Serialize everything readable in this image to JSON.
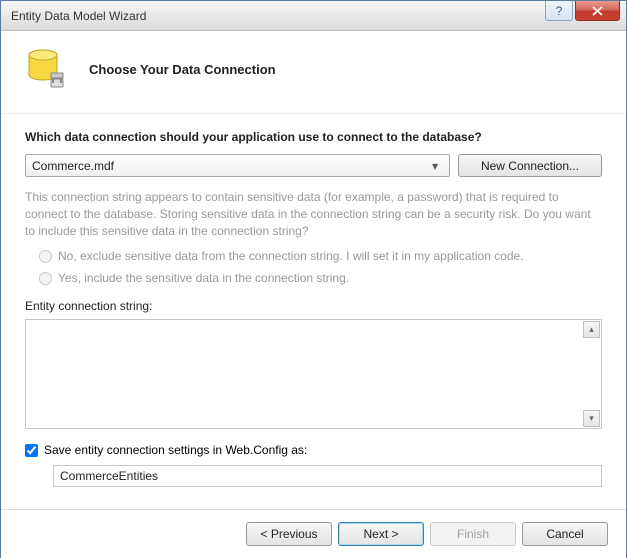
{
  "window": {
    "title": "Entity Data Model Wizard"
  },
  "header": {
    "heading": "Choose Your Data Connection"
  },
  "question": "Which data connection should your application use to connect to the database?",
  "connection": {
    "selected": "Commerce.mdf",
    "new_button": "New Connection..."
  },
  "sensitive_note": "This connection string appears to contain sensitive data (for example, a password) that is required to connect to the database. Storing sensitive data in the connection string can be a security risk. Do you want to include this sensitive data in the connection string?",
  "radios": {
    "exclude": "No, exclude sensitive data from the connection string. I will set it in my application code.",
    "include": "Yes, include the sensitive data in the connection string."
  },
  "conn_string_label": "Entity connection string:",
  "save_settings": {
    "checked": true,
    "label": "Save entity connection settings in Web.Config as:",
    "value": "CommerceEntities"
  },
  "buttons": {
    "previous": "< Previous",
    "next": "Next >",
    "finish": "Finish",
    "cancel": "Cancel"
  }
}
